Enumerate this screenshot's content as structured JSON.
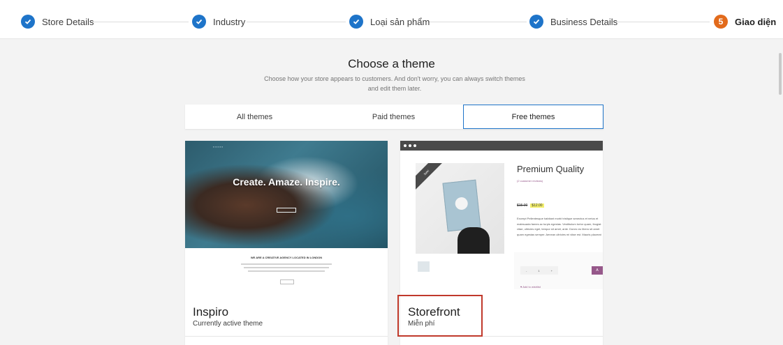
{
  "stepper": {
    "steps": [
      {
        "label": "Store Details",
        "state": "done"
      },
      {
        "label": "Industry",
        "state": "done"
      },
      {
        "label": "Loại sản phẩm",
        "state": "done"
      },
      {
        "label": "Business Details",
        "state": "done"
      },
      {
        "label": "Giao diện",
        "number": "5",
        "state": "current"
      }
    ]
  },
  "header": {
    "title": "Choose a theme",
    "subtitle": "Choose how your store appears to customers. And don't worry, you can always switch themes and edit them later."
  },
  "tabs": [
    {
      "label": "All themes",
      "active": false
    },
    {
      "label": "Paid themes",
      "active": false
    },
    {
      "label": "Free themes",
      "active": true
    }
  ],
  "themes": [
    {
      "name": "Inspiro",
      "status": "Currently active theme",
      "preview": {
        "headline": "Create. Amaze. Inspire.",
        "agency_line": "WE ARE A CREATIVE AGENCY LOCATED IN LONDON"
      }
    },
    {
      "name": "Storefront",
      "status": "Miễn phí",
      "preview": {
        "sale_badge": "Sale!",
        "product_title": "Premium Quality",
        "reviews": "(2 customer reviews)",
        "old_price": "$15.00",
        "new_price": "$12.00",
        "description": "Excerpt Pellentesque habitant morbi tristique senectus et netus et malesuada fames ac turpis egestas. Vestibulum tortor quam, feugiat vitae, ultricies eget, tempor sit amet, ante. Donec eu libero sit amet quam egestas semper. Aenean ultricies mi vitae est. Mauris placerat",
        "qty_minus": "-",
        "qty_value": "1",
        "qty_plus": "+",
        "add_button": "A",
        "wishlist": "Add to wishlist"
      }
    }
  ],
  "colors": {
    "accent": "#1e74c9",
    "current_step": "#e26a1b",
    "highlight": "#c0392b"
  }
}
